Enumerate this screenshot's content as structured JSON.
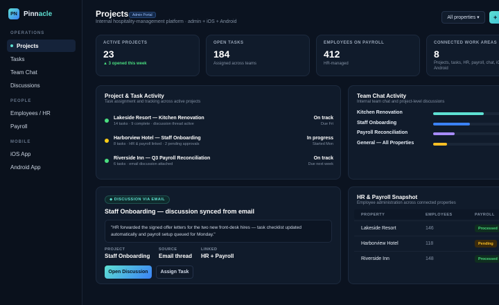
{
  "brand": {
    "logo": "PN",
    "name_main": "Pinn",
    "name_accent": "acle"
  },
  "sidebar": {
    "sections": [
      {
        "title": "OPERATIONS",
        "items": [
          {
            "label": "Projects",
            "active": true
          },
          {
            "label": "Tasks"
          },
          {
            "label": "Team Chat"
          },
          {
            "label": "Discussions"
          }
        ]
      },
      {
        "title": "PEOPLE",
        "items": [
          {
            "label": "Employees / HR"
          },
          {
            "label": "Payroll"
          }
        ]
      },
      {
        "title": "MOBILE",
        "items": [
          {
            "label": "iOS App"
          },
          {
            "label": "Android App"
          }
        ]
      }
    ]
  },
  "header": {
    "title": "Projects",
    "badge": "Admin Portal",
    "subtitle": "Internal hospitality-management platform · admin + iOS + Android",
    "filter_label": "All properties ▾",
    "add_label": "+"
  },
  "stats": [
    {
      "label": "ACTIVE PROJECTS",
      "value": "23",
      "note": "▲ 3 opened this week",
      "good": true
    },
    {
      "label": "OPEN TASKS",
      "value": "184",
      "note": "Assigned across teams"
    },
    {
      "label": "EMPLOYEES ON PAYROLL",
      "value": "412",
      "note": "HR-managed"
    },
    {
      "label": "CONNECTED WORK AREAS",
      "value": "8",
      "note": "Projects, tasks, HR, payroll, chat, iOS, Android"
    }
  ],
  "activity": {
    "title": "Project & Task Activity",
    "subtitle": "Task assignment and tracking across active projects",
    "rows": [
      {
        "title": "Lakeside Resort — Kitchen Renovation",
        "meta": "14 tasks · 9 complete · discussion thread active",
        "status": "On track",
        "due": "Due Fri",
        "color": "#4ade80"
      },
      {
        "title": "Harborview Hotel — Staff Onboarding",
        "meta": "8 tasks · HR & payroll linked · 2 pending approvals",
        "status": "In progress",
        "due": "Started Mon",
        "color": "#facc15"
      },
      {
        "title": "Riverside Inn — Q3 Payroll Reconciliation",
        "meta": "6 tasks · email discussion attached",
        "status": "On track",
        "due": "Due next week",
        "color": "#4ade80"
      }
    ]
  },
  "team_chat": {
    "title": "Team Chat Activity",
    "subtitle": "Internal team chat and project-level discussions",
    "rows": [
      {
        "label": "Kitchen Renovation",
        "level": 0.66,
        "color": "#5ee0d2"
      },
      {
        "label": "Staff Onboarding",
        "level": 0.48,
        "color": "#3b82f6"
      },
      {
        "label": "Payroll Reconciliation",
        "level": 0.28,
        "color": "#a78bfa"
      },
      {
        "label": "General — All Properties",
        "level": 0.18,
        "color": "#fbbf24"
      }
    ]
  },
  "discussion": {
    "badge": "◆ DISCUSSION VIA EMAIL",
    "title": "Staff Onboarding — discussion synced from email",
    "quote": "\"HR forwarded the signed offer letters for the two new front-desk hires — task checklist updated automatically and payroll setup queued for Monday.\"",
    "meta": [
      {
        "label": "PROJECT",
        "value": "Staff Onboarding"
      },
      {
        "label": "SOURCE",
        "value": "Email thread"
      },
      {
        "label": "LINKED",
        "value": "HR + Payroll"
      }
    ],
    "primary_button": "Open Discussion",
    "secondary_button": "Assign Task"
  },
  "payroll": {
    "title": "HR & Payroll Snapshot",
    "subtitle": "Employee administration across connected properties",
    "columns": [
      "PROPERTY",
      "EMPLOYEES",
      "PAYROLL"
    ],
    "rows": [
      {
        "property": "Lakeside Resort",
        "employees": "146",
        "status": "Processed"
      },
      {
        "property": "Harborview Hotel",
        "employees": "118",
        "status": "Pending"
      },
      {
        "property": "Riverside Inn",
        "employees": "148",
        "status": "Processed"
      }
    ],
    "status_colors": {
      "Processed": {
        "bg": "#0f2e1f",
        "fg": "#4ade80"
      },
      "Pending": {
        "bg": "#3a2a0c",
        "fg": "#fbbf24"
      }
    }
  }
}
